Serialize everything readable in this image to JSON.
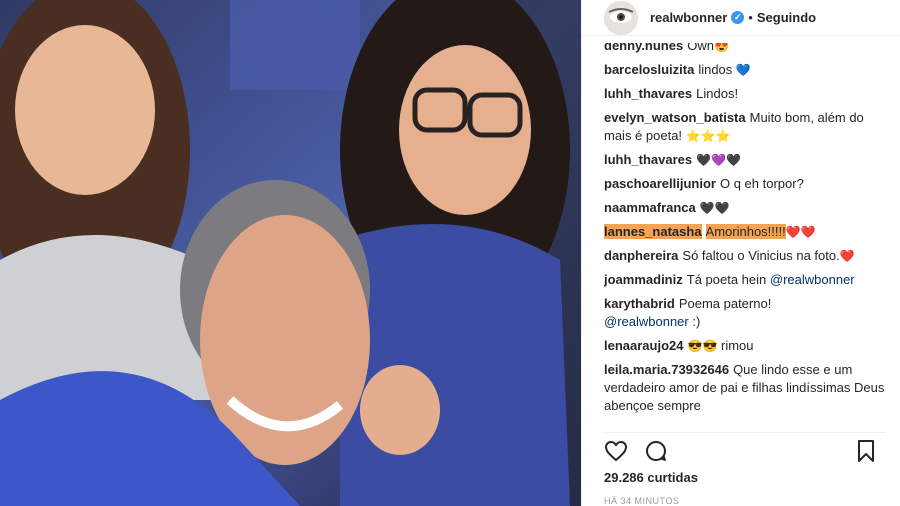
{
  "post": {
    "username": "realwbonner",
    "follow_status": "Seguindo",
    "dot": "•",
    "verified_glyph": "✓",
    "likes": "29.286 curtidas",
    "time": "HÁ 34 MINUTOS"
  },
  "comments": [
    {
      "user": "denny.nunes",
      "text": "Own",
      "emoji": "😍"
    },
    {
      "user": "barcelosluizita",
      "text": "lindos",
      "emoji": "💙"
    },
    {
      "user": "luhh_thavares",
      "text": "Lindos!",
      "emoji": ""
    },
    {
      "user": "evelyn_watson_batista",
      "text": "Muito bom, além do mais é poeta!",
      "emoji": "⭐⭐⭐"
    },
    {
      "user": "luhh_thavares",
      "text": "",
      "emoji": "🖤💜🖤"
    },
    {
      "user": "paschoarellijunior",
      "text": "O q eh torpor?",
      "emoji": ""
    },
    {
      "user": "naammafranca",
      "text": "",
      "emoji": "🖤🖤"
    },
    {
      "user": "lannes_natasha",
      "text": "Amorinhos!!!!!",
      "emoji": "❤️❤️",
      "highlight": true
    },
    {
      "user": "danphereira",
      "text": "Só faltou o Vinicius na foto.",
      "emoji": "❤️"
    },
    {
      "user": "joammadiniz",
      "text": "Tá poeta hein",
      "mention": "@realwbonner"
    },
    {
      "user": "karythabrid",
      "text": "Poema paterno!",
      "mention": "@realwbonner",
      "suffix": ":)"
    },
    {
      "user": "lenaaraujo24",
      "text": "",
      "emoji": "😎😎",
      "suffix": "rimou"
    },
    {
      "user": "leila.maria.73932646",
      "text": "Que lindo esse e um verdadeiro amor de pai e filhas lindíssimas Deus abençoe sempre",
      "emoji": ""
    }
  ],
  "icons": {
    "like": "heart-icon",
    "comment": "comment-icon",
    "save": "bookmark-icon"
  },
  "colors": {
    "highlight": "#f5a352",
    "verified": "#3897f0",
    "mention": "#003569"
  }
}
